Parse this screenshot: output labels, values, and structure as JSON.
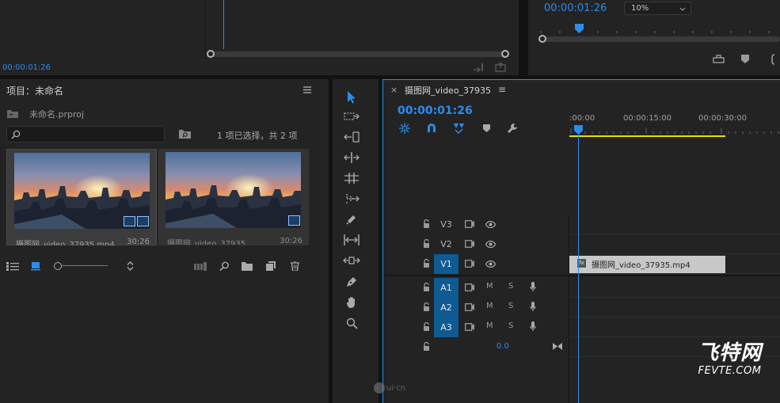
{
  "source_monitor": {
    "timecode": "00:00:01:26"
  },
  "program_monitor": {
    "timecode": "00:00:01:26",
    "zoom": "10%"
  },
  "project": {
    "title": "项目：未命名",
    "file": "未命名.prproj",
    "selection_info": "1 项已选择，共 2 项",
    "search_placeholder": "",
    "items": [
      {
        "name": "摄图网_video_37935.mp4",
        "duration": "30:26",
        "selected": true
      },
      {
        "name": "摄图网_video_37935",
        "duration": "30:26",
        "selected": false
      }
    ]
  },
  "timeline": {
    "tab_close": "×",
    "title": "摄图网_video_37935",
    "menu_glyph": "≡",
    "timecode": "00:00:01:26",
    "ruler_labels": [
      ":00:00",
      "00:00:15:00",
      "00:00:30:00"
    ],
    "video_tracks": [
      {
        "name": "V3",
        "targeted": false
      },
      {
        "name": "V2",
        "targeted": false
      },
      {
        "name": "V1",
        "targeted": true
      }
    ],
    "audio_tracks": [
      {
        "name": "A1",
        "mute": "M",
        "solo": "S"
      },
      {
        "name": "A2",
        "mute": "M",
        "solo": "S"
      },
      {
        "name": "A3",
        "mute": "M",
        "solo": "S"
      }
    ],
    "master_value": "0.0",
    "clip": {
      "label": "摄图网_video_37935.mp4",
      "fx": "fx"
    }
  },
  "watermarks": {
    "ui_cn": "ui·cn",
    "brand_cn": "飞特网",
    "brand_en": "FEVTE.COM"
  },
  "colors": {
    "accent": "#2d8ceb",
    "track_selected": "#0e5a93",
    "work_area": "#e8e000",
    "clip": "#c8c8c8"
  }
}
